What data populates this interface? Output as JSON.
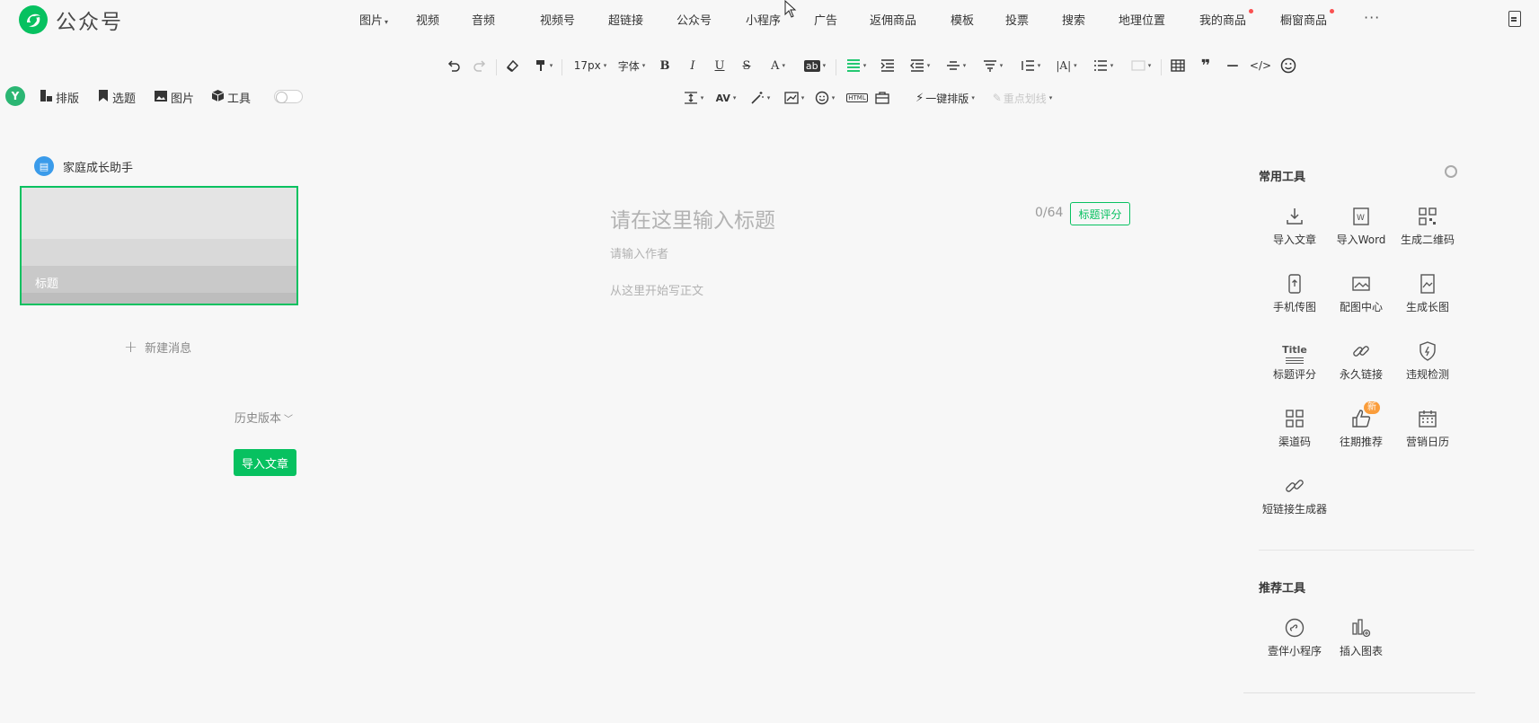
{
  "app": {
    "logo_text": "公众号"
  },
  "nav": [
    {
      "label": "图片",
      "caret": true,
      "dot": false
    },
    {
      "label": "视频",
      "caret": false,
      "dot": false
    },
    {
      "label": "音频",
      "caret": false,
      "dot": false
    },
    {
      "label": "视频号",
      "caret": false,
      "dot": false
    },
    {
      "label": "超链接",
      "caret": false,
      "dot": false
    },
    {
      "label": "公众号",
      "caret": false,
      "dot": false
    },
    {
      "label": "小程序",
      "caret": false,
      "dot": false
    },
    {
      "label": "广告",
      "caret": false,
      "dot": false
    },
    {
      "label": "返佣商品",
      "caret": false,
      "dot": false
    },
    {
      "label": "模板",
      "caret": false,
      "dot": false
    },
    {
      "label": "投票",
      "caret": false,
      "dot": false
    },
    {
      "label": "搜索",
      "caret": false,
      "dot": false
    },
    {
      "label": "地理位置",
      "caret": false,
      "dot": false
    },
    {
      "label": "我的商品",
      "caret": false,
      "dot": true
    },
    {
      "label": "橱窗商品",
      "caret": false,
      "dot": true
    }
  ],
  "nav_more": "···",
  "toolbar": {
    "font_size": "17px",
    "font_family": "字体",
    "bold": "B",
    "italic": "I",
    "underline": "U",
    "strike": "S",
    "font_color": "A",
    "bg_color": "ab",
    "one_click_layout": "一键排版",
    "highlight": "重点划线",
    "html": "HTML",
    "quote": "❞",
    "hr": "—",
    "code": "</>"
  },
  "plugin": {
    "logo": "Y",
    "items": [
      "排版",
      "选题",
      "图片",
      "工具"
    ]
  },
  "sidebar": {
    "account_name": "家庭成长助手",
    "card_title": "标题",
    "new_message": "新建消息",
    "history": "历史版本",
    "import_button": "导入文章"
  },
  "editor": {
    "title_placeholder": "请在这里输入标题",
    "title_count": "0/64",
    "title_score_button": "标题评分",
    "author_placeholder": "请输入作者",
    "body_placeholder": "从这里开始写正文"
  },
  "right_panel": {
    "common_title": "常用工具",
    "common_tools": [
      {
        "label": "导入文章",
        "icon": "import-article-icon"
      },
      {
        "label": "导入Word",
        "icon": "word-icon"
      },
      {
        "label": "生成二维码",
        "icon": "qrcode-icon"
      },
      {
        "label": "手机传图",
        "icon": "phone-upload-icon"
      },
      {
        "label": "配图中心",
        "icon": "image-center-icon"
      },
      {
        "label": "生成长图",
        "icon": "long-image-icon"
      },
      {
        "label": "标题评分",
        "icon": "title-score-icon"
      },
      {
        "label": "永久链接",
        "icon": "link-icon"
      },
      {
        "label": "违规检测",
        "icon": "shield-icon"
      },
      {
        "label": "渠道码",
        "icon": "channel-code-icon"
      },
      {
        "label": "往期推荐",
        "icon": "thumb-up-icon",
        "badge": "新"
      },
      {
        "label": "营销日历",
        "icon": "calendar-icon"
      },
      {
        "label": "短链接生成器",
        "icon": "short-link-icon"
      }
    ],
    "title_icon_text": "Title",
    "recommend_title": "推荐工具",
    "recommend_tools": [
      {
        "label": "壹伴小程序",
        "icon": "mini-program-icon"
      },
      {
        "label": "插入图表",
        "icon": "chart-icon"
      }
    ]
  }
}
